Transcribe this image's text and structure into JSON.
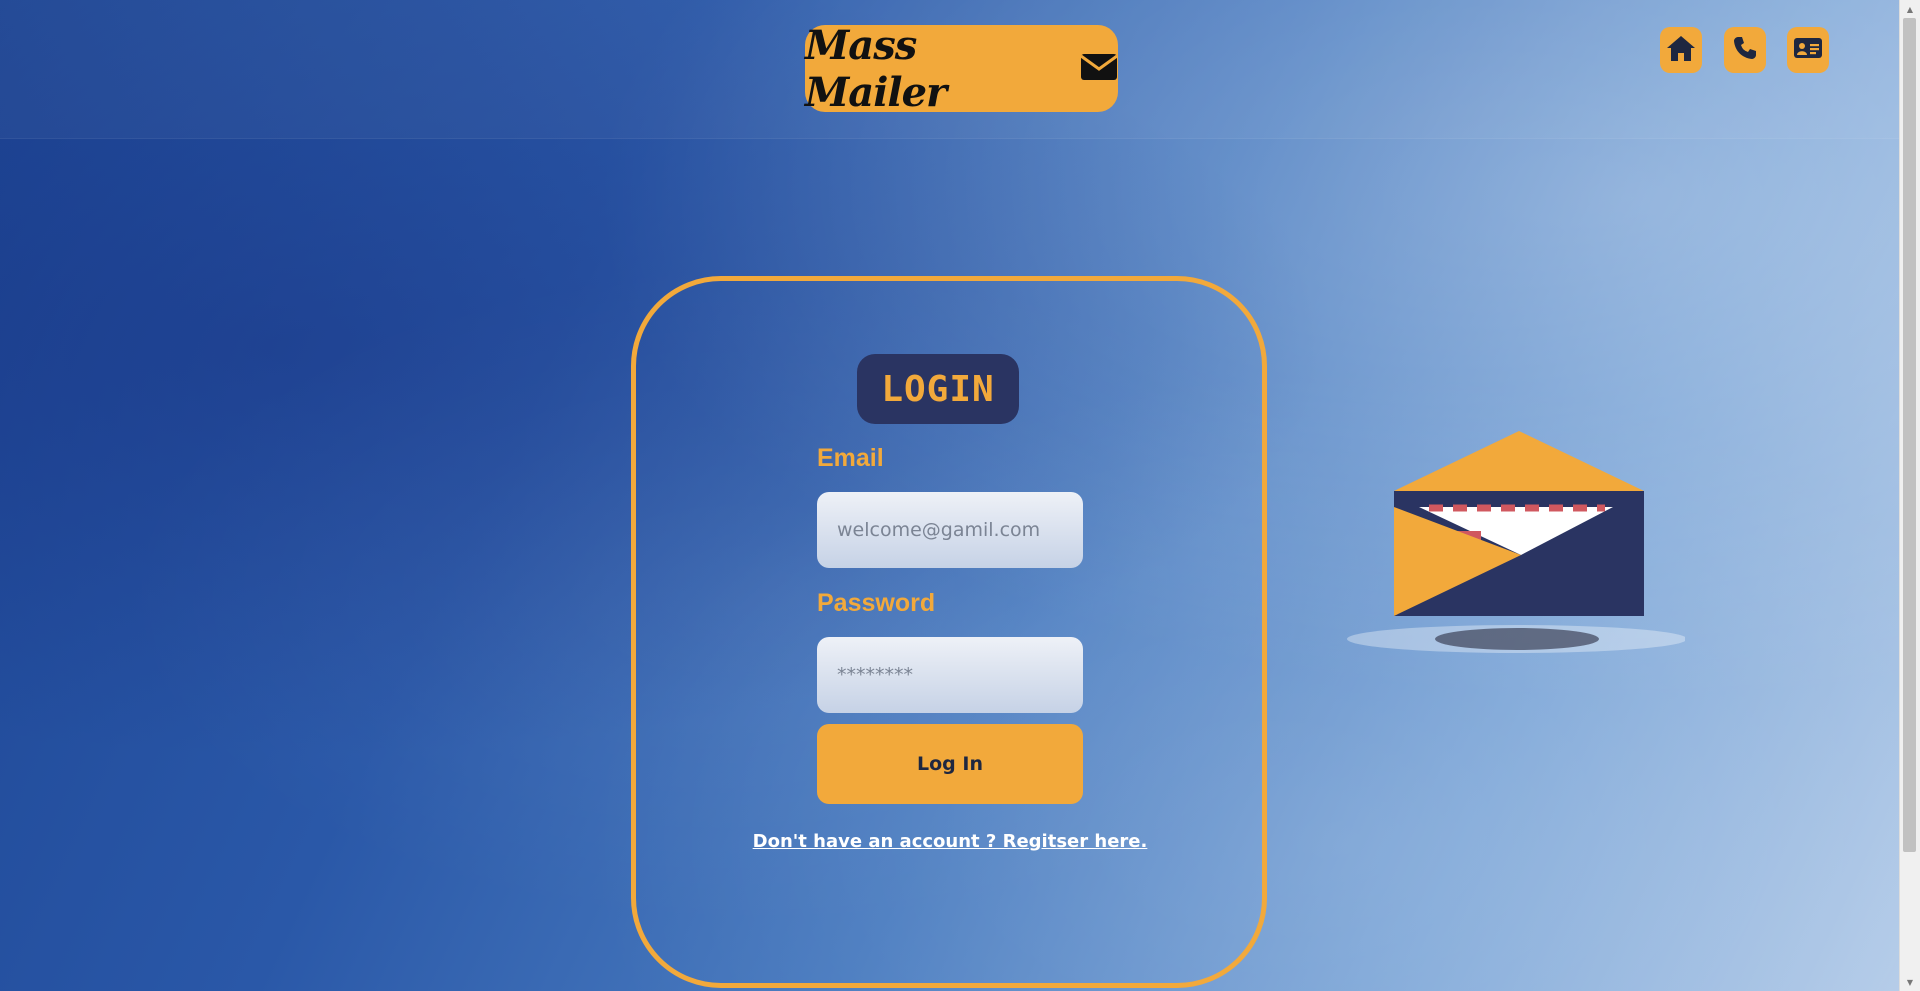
{
  "brand": {
    "title": "Mass Mailer"
  },
  "nav": {
    "items": [
      {
        "icon": "home-icon"
      },
      {
        "icon": "phone-icon"
      },
      {
        "icon": "contact-card-icon"
      }
    ]
  },
  "login": {
    "heading": "LOGIN",
    "email_label": "Email",
    "email_placeholder": "welcome@gamil.com",
    "password_label": "Password",
    "password_placeholder": "********",
    "submit_label": "Log In",
    "register_link": "Don't have an account ? Regitser here."
  },
  "colors": {
    "accent": "#f2a93b",
    "navy": "#2a3462",
    "background_start": "#1d4594",
    "background_end": "#b6cde9"
  }
}
